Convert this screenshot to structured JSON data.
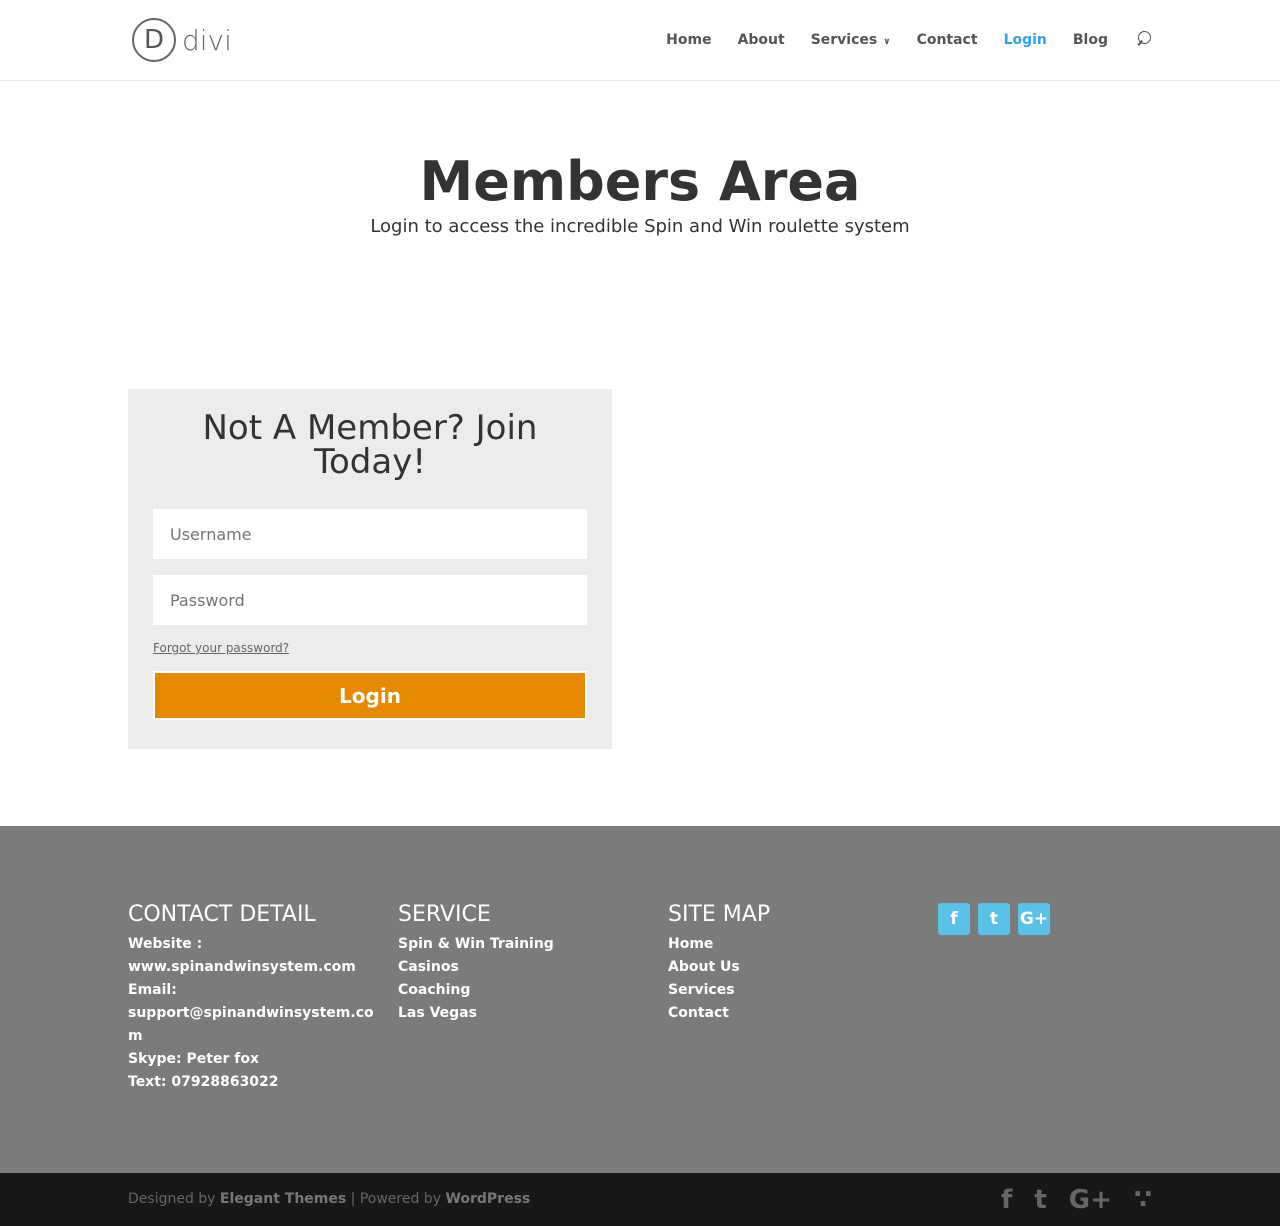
{
  "logo": {
    "mark": "D",
    "text": "divi"
  },
  "nav": [
    "Home",
    "About",
    "Services",
    "Contact",
    "Login",
    "Blog"
  ],
  "hero": {
    "title": "Members Area",
    "subtitle": "Login to access the incredible Spin and Win roulette system"
  },
  "form": {
    "title": "Not A Member? Join Today!",
    "username_placeholder": "Username",
    "password_placeholder": "Password",
    "forgot": "Forgot your password?",
    "login": "Login"
  },
  "footer": {
    "contact": {
      "title": "CONTACT DETAIL",
      "lines": [
        "Website :",
        "www.spinandwinsystem.com",
        "Email:",
        "support@spinandwinsystem.co",
        "m",
        "Skype: Peter fox",
        "Text: 07928863022"
      ]
    },
    "service": {
      "title": "SERVICE",
      "items": [
        "Spin & Win Training",
        "Casinos",
        "Coaching",
        "Las Vegas"
      ]
    },
    "sitemap": {
      "title": "SITE MAP",
      "items": [
        "Home",
        "About Us",
        "Services",
        "Contact"
      ]
    },
    "social": [
      "f",
      "t",
      "G+"
    ]
  },
  "bottom": {
    "designed": "Designed by ",
    "et": "Elegant Themes",
    "sep": " | Powered by ",
    "wp": "WordPress",
    "icons": [
      "f",
      "t",
      "G+",
      "rss"
    ]
  }
}
